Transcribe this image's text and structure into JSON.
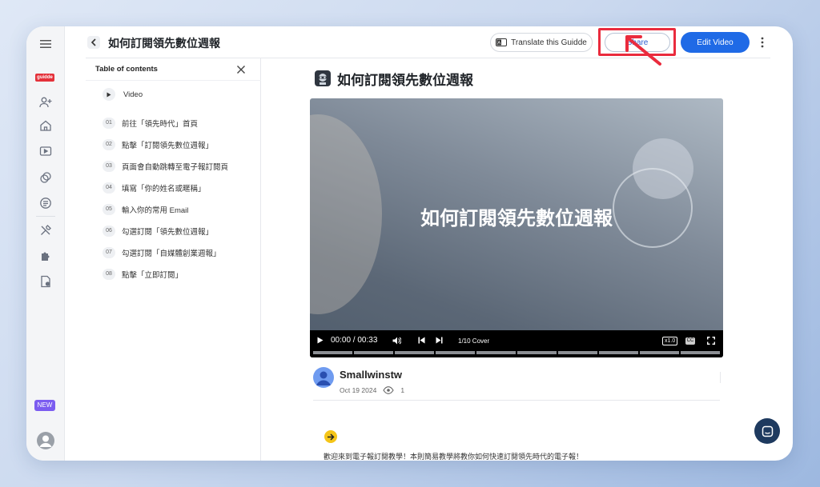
{
  "brand": {
    "badge": "guidde"
  },
  "header": {
    "title": "如何訂閱領先數位週報",
    "translate_label": "Translate this Guidde",
    "share_label": "Share",
    "edit_label": "Edit Video"
  },
  "rail": {
    "new_badge": "NEW"
  },
  "toc": {
    "title": "Table of contents",
    "video_label": "Video",
    "items": [
      {
        "num": "01",
        "label": "前往「領先時代」首頁"
      },
      {
        "num": "02",
        "label": "點擊「訂閱領先數位週報」"
      },
      {
        "num": "03",
        "label": "頁面會自動跳轉至電子報訂閱頁"
      },
      {
        "num": "04",
        "label": "填寫「你的姓名或暱稱」"
      },
      {
        "num": "05",
        "label": "輸入你的常用 Email"
      },
      {
        "num": "06",
        "label": "勾選訂閱「領先數位週報」"
      },
      {
        "num": "07",
        "label": "勾選訂閱「自媒體創業週報」"
      },
      {
        "num": "08",
        "label": "點擊「立即訂閱」"
      }
    ]
  },
  "main": {
    "doc_title": "如何訂閱領先數位週報",
    "video": {
      "title": "如何訂閱領先數位週報",
      "time": "00:00 / 00:33",
      "chapter": "1/10 Cover",
      "speed": "x1.0",
      "cc": "CC",
      "segments": 10
    },
    "author": {
      "name": "Smallwinstw",
      "date": "Oct 19 2024",
      "views": "1"
    },
    "intro": "歡迎來到電子報訂閱教學！本則簡易教學將教你如何快速訂閱領先時代的電子報！"
  },
  "colors": {
    "accent": "#1f6ae6",
    "highlight": "#ea2b3d",
    "new_badge": "#7b5cf0",
    "brand_red": "#e4313a",
    "arrow_yellow": "#f5c518"
  }
}
